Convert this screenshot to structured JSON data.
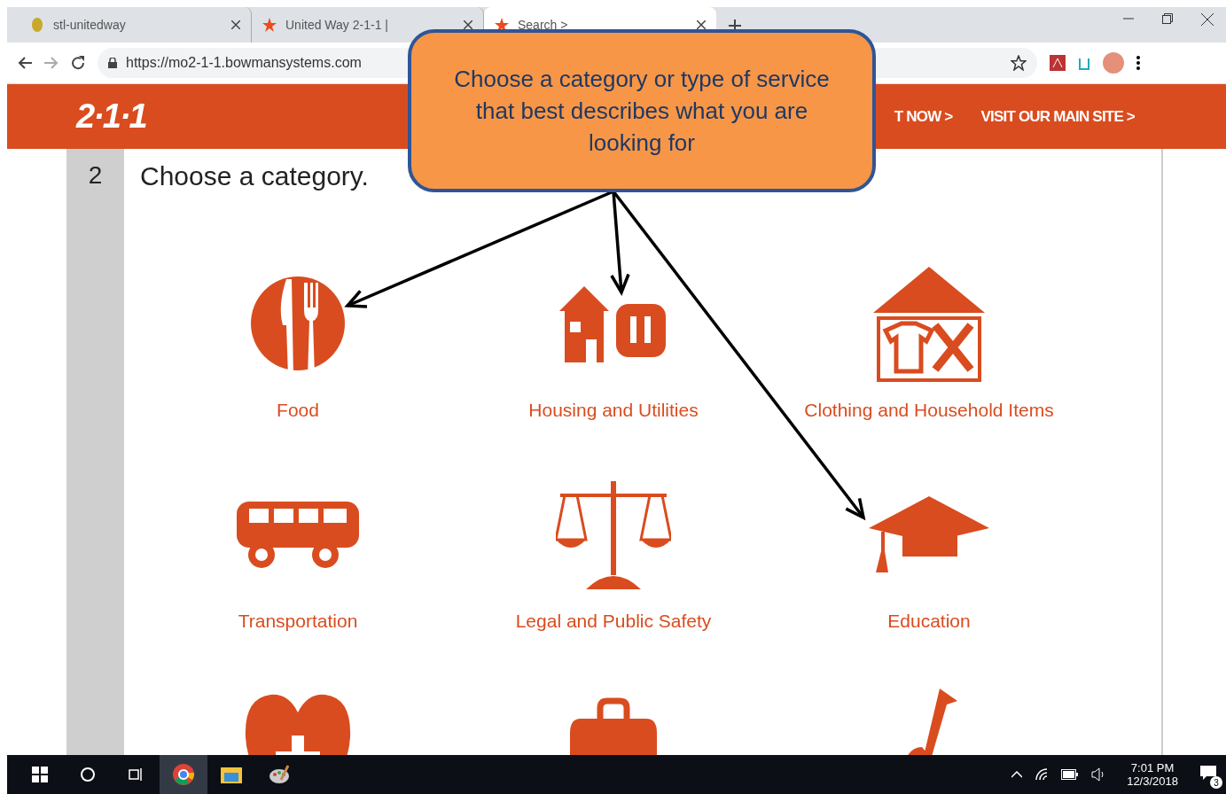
{
  "browser": {
    "tabs": [
      {
        "title": "stl-unitedway",
        "selected": false
      },
      {
        "title": "United Way 2-1-1 |",
        "selected": false
      },
      {
        "title": "Search >",
        "selected": true
      }
    ],
    "url": "https://mo2-1-1.bowmansystems.com"
  },
  "site_header": {
    "logo": "2·1·1",
    "nav": [
      "T NOW >",
      "VISIT OUR MAIN SITE >"
    ]
  },
  "step": {
    "number": "2",
    "title": "Choose a category."
  },
  "categories": [
    {
      "kind": "food",
      "label": "Food"
    },
    {
      "kind": "housing",
      "label": "Housing and Utilities"
    },
    {
      "kind": "clothing",
      "label": "Clothing and Household Items"
    },
    {
      "kind": "transport",
      "label": "Transportation"
    },
    {
      "kind": "legal",
      "label": "Legal and Public Safety"
    },
    {
      "kind": "education",
      "label": "Education"
    },
    {
      "kind": "health"
    },
    {
      "kind": "work"
    },
    {
      "kind": "music"
    }
  ],
  "callout": {
    "text": "Choose a category or type of service that best describes what you are looking for"
  },
  "taskbar": {
    "time": "7:01 PM",
    "date": "12/3/2018",
    "notifications": "3"
  }
}
